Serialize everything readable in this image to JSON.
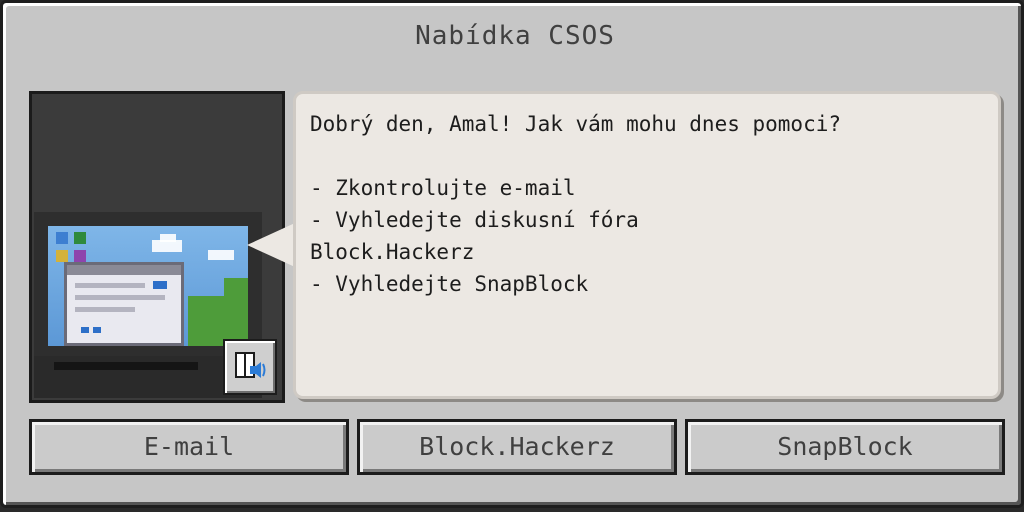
{
  "dialog": {
    "title": "Nabídka CSOS"
  },
  "npc": {
    "portrait_icon": "computer-monitor",
    "voice_button_icon": "book-speaker-icon"
  },
  "message": {
    "text": "Dobrý den, Amal! Jak vám mohu dnes pomoci?\n\n- Zkontrolujte e-mail\n- Vyhledejte diskusní fóra\nBlock.Hackerz\n- Vyhledejte SnapBlock"
  },
  "buttons": [
    {
      "label": "E-mail"
    },
    {
      "label": "Block.Hackerz"
    },
    {
      "label": "SnapBlock"
    }
  ],
  "colors": {
    "panel": "#c6c6c6",
    "bubble": "#ece8e3",
    "text": "#404040"
  }
}
